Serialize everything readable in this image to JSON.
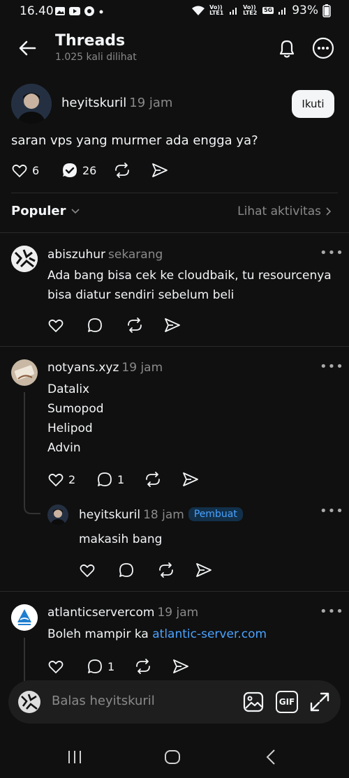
{
  "status_bar": {
    "time": "16.40",
    "sim1_label": "Vo)) LTE1",
    "sim2_label": "Vo)) LTE2",
    "net_label": "5G",
    "battery": "93%"
  },
  "header": {
    "title": "Threads",
    "views": "1.025 kali dilihat"
  },
  "post": {
    "username": "heyitskuril",
    "time": "19 jam",
    "follow_label": "Ikuti",
    "text": "saran vps yang murmer ada engga ya?",
    "likes": "6",
    "replies": "26"
  },
  "sort": {
    "label": "Populer",
    "activity_label": "Lihat aktivitas"
  },
  "comments": [
    {
      "username": "abiszuhur",
      "time": "sekarang",
      "lines": [
        "Ada bang bisa cek ke cloudbaik, tu resourcenya",
        "bisa diatur sendiri sebelum beli"
      ]
    },
    {
      "username": "notyans.xyz",
      "time": "19 jam",
      "lines": [
        "Datalix",
        "Sumopod",
        "Helipod",
        "Advin"
      ],
      "likes": "2",
      "replies": "1"
    },
    {
      "username": "heyitskuril",
      "time": "18 jam",
      "badge": "Pembuat",
      "lines": [
        "makasih bang"
      ]
    },
    {
      "username": "atlanticservercom",
      "time": "19 jam",
      "text_prefix": "Boleh mampir ka ",
      "link": "atlantic-server.com",
      "replies": "1"
    }
  ],
  "reply_bar": {
    "placeholder": "Balas heyitskuril",
    "gif_label": "GIF"
  },
  "colors": {
    "background": "#101010",
    "link": "#4aa3ff",
    "badge_bg": "#12304a"
  }
}
